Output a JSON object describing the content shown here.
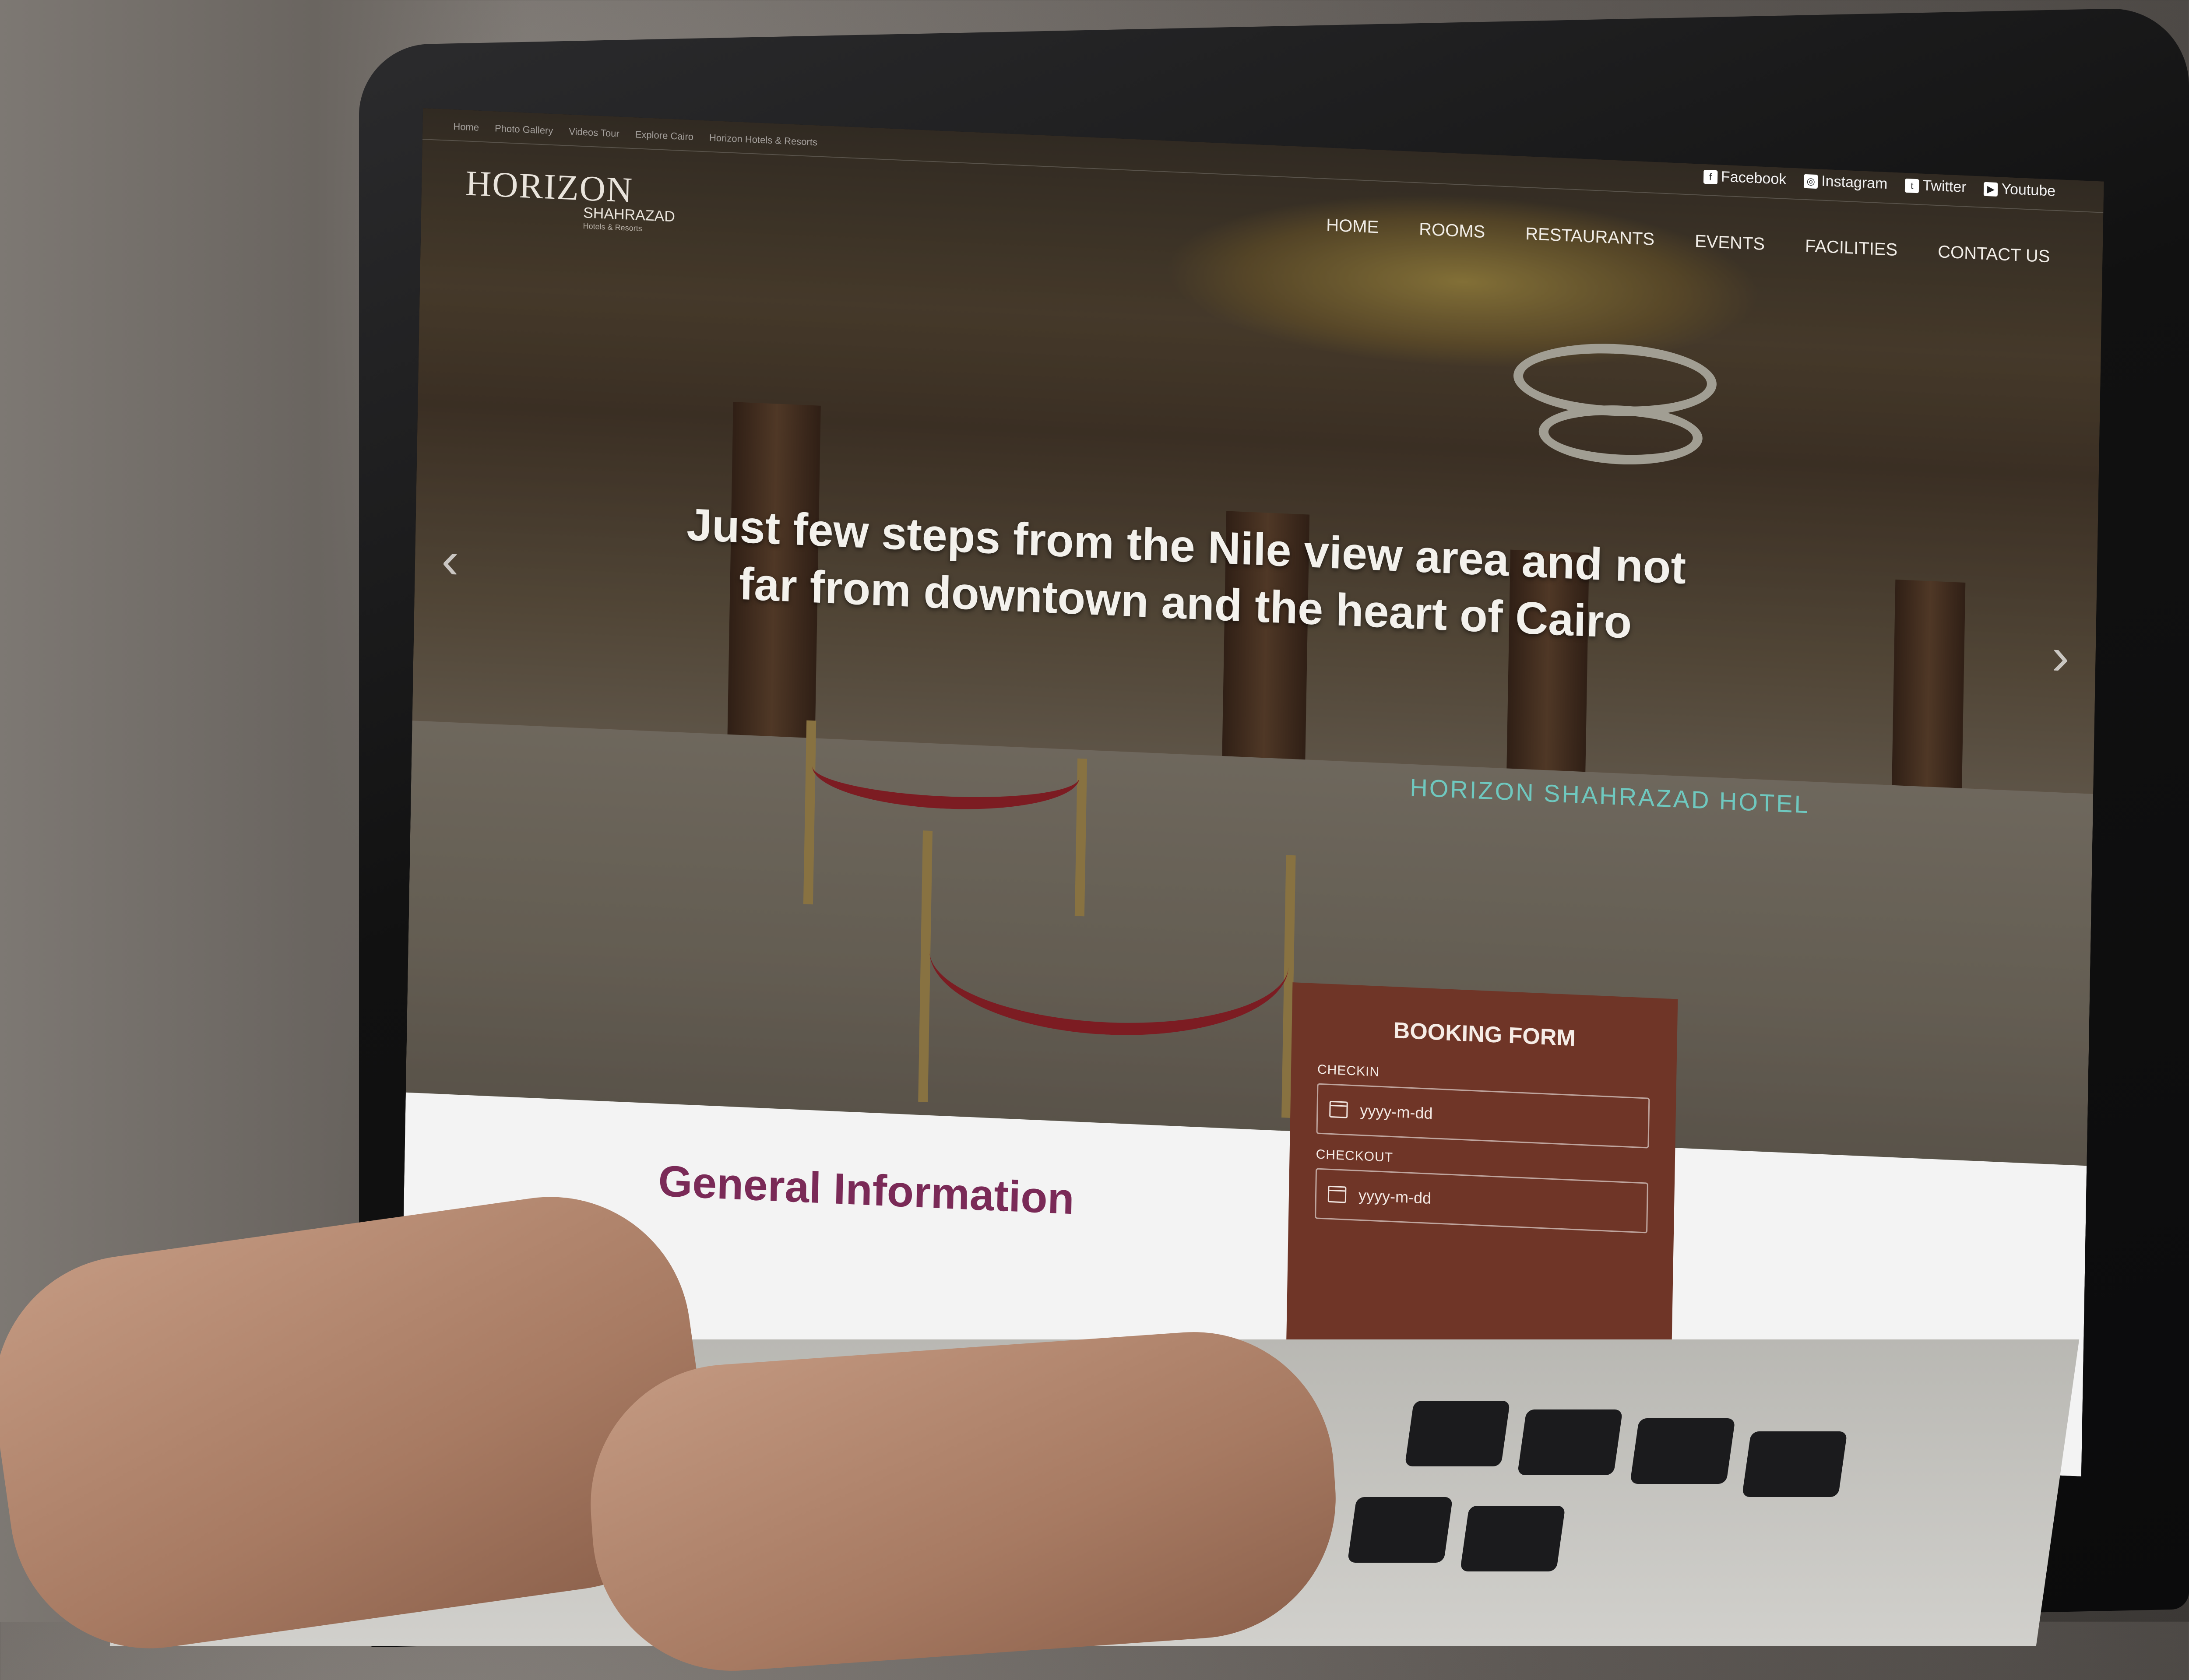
{
  "topbar": {
    "breadcrumbs": [
      "Home",
      "Photo Gallery",
      "Videos Tour",
      "Explore Cairo",
      "Horizon Hotels & Resorts"
    ],
    "social": [
      {
        "icon": "facebook-icon",
        "label": "Facebook"
      },
      {
        "icon": "instagram-icon",
        "label": "Instagram"
      },
      {
        "icon": "twitter-icon",
        "label": "Twitter"
      },
      {
        "icon": "youtube-icon",
        "label": "Youtube"
      }
    ]
  },
  "logo": {
    "name": "HORIZON",
    "sub": "SHAHRAZAD",
    "tagline": "Hotels & Resorts"
  },
  "nav": [
    "HOME",
    "ROOMS",
    "RESTAURANTS",
    "EVENTS",
    "FACILITIES",
    "CONTACT US"
  ],
  "hero": {
    "caption": "Just few steps from the Nile view area and not far from downtown and the heart of Cairo",
    "hotel_name": "HORIZON SHAHRAZAD HOTEL"
  },
  "content": {
    "section_title": "General Information"
  },
  "booking": {
    "title": "BOOKING FORM",
    "checkin_label": "CHECKIN",
    "checkin_placeholder": "yyyy-m-dd",
    "checkout_label": "CHECKOUT",
    "checkout_placeholder": "yyyy-m-dd"
  },
  "colors": {
    "accent": "#7a2a57",
    "booking_bg": "#6f3527",
    "hotel_name": "#6fc8bf"
  }
}
